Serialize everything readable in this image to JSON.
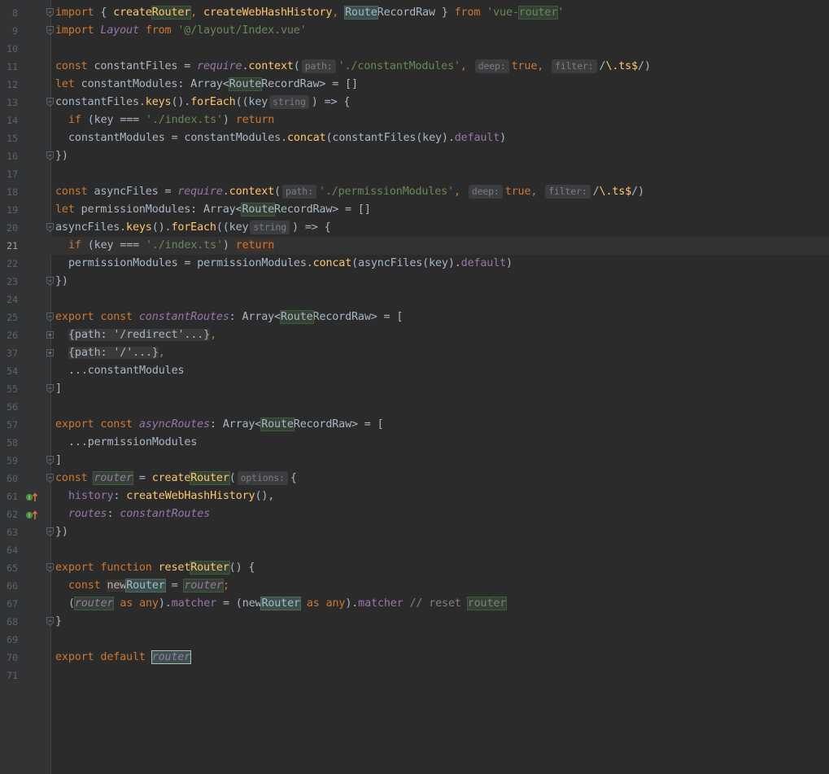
{
  "editor": {
    "current_line": "21",
    "lines": [
      {
        "n": "8"
      },
      {
        "n": "9"
      },
      {
        "n": "10"
      },
      {
        "n": "11"
      },
      {
        "n": "12"
      },
      {
        "n": "13"
      },
      {
        "n": "14"
      },
      {
        "n": "15"
      },
      {
        "n": "16"
      },
      {
        "n": "17"
      },
      {
        "n": "18"
      },
      {
        "n": "19"
      },
      {
        "n": "20"
      },
      {
        "n": "21"
      },
      {
        "n": "22"
      },
      {
        "n": "23"
      },
      {
        "n": "24"
      },
      {
        "n": "25"
      },
      {
        "n": "26"
      },
      {
        "n": "37"
      },
      {
        "n": "54"
      },
      {
        "n": "55"
      },
      {
        "n": "56"
      },
      {
        "n": "57"
      },
      {
        "n": "58"
      },
      {
        "n": "59"
      },
      {
        "n": "60"
      },
      {
        "n": "61"
      },
      {
        "n": "62"
      },
      {
        "n": "63"
      },
      {
        "n": "64"
      },
      {
        "n": "65"
      },
      {
        "n": "66"
      },
      {
        "n": "67"
      },
      {
        "n": "68"
      },
      {
        "n": "69"
      },
      {
        "n": "70"
      },
      {
        "n": "71"
      }
    ],
    "tokens": {
      "l8": [
        "import",
        " { ",
        "create",
        "Router",
        ", ",
        "createWebHashHistory",
        ", ",
        "Route",
        "RecordRaw",
        " } ",
        "from",
        " ",
        "'vue-",
        "router",
        "'"
      ],
      "l9": [
        "import",
        " ",
        "Layout",
        " ",
        "from",
        " ",
        "'@/layout/Index.vue'"
      ],
      "l11": [
        "const",
        " constantFiles = ",
        "require",
        ".",
        "context",
        "(",
        "path:",
        "'./constantModules'",
        ", ",
        "deep:",
        "true",
        ", ",
        "filter:",
        "/",
        "\\.ts",
        "$",
        "/",
        ")"
      ],
      "l12": [
        "let",
        " constantModules: Array<",
        "Route",
        "RecordRaw> = []"
      ],
      "l13": [
        "constantFiles.",
        "keys",
        "().",
        "forEach",
        "((key",
        "string",
        ") => {"
      ],
      "l14": [
        "if",
        " (key === ",
        "'./index.ts'",
        ") ",
        "return"
      ],
      "l15": [
        "constantModules = constantModules.",
        "concat",
        "(constantFiles(key).",
        "default",
        ")"
      ],
      "l16": [
        "})"
      ],
      "l18": [
        "const",
        " asyncFiles = ",
        "require",
        ".",
        "context",
        "(",
        "path:",
        "'./permissionModules'",
        ", ",
        "deep:",
        "true",
        ", ",
        "filter:",
        "/",
        "\\.ts",
        "$",
        "/",
        ")"
      ],
      "l19": [
        "let",
        " permissionModules: Array<",
        "Route",
        "RecordRaw> = []"
      ],
      "l20": [
        "asyncFiles.",
        "keys",
        "().",
        "forEach",
        "((key",
        "string",
        ") => {"
      ],
      "l21": [
        "if",
        " (key === ",
        "'./index.ts'",
        ") ",
        "return"
      ],
      "l22": [
        "permissionModules = permissionModules.",
        "concat",
        "(asyncFiles(key).",
        "default",
        ")"
      ],
      "l23": [
        "})"
      ],
      "l25": [
        "export",
        " ",
        "const",
        " ",
        "constantRoutes",
        ": Array<",
        "Route",
        "RecordRaw> = ["
      ],
      "l26": [
        "{path: '/redirect'...}",
        ","
      ],
      "l37": [
        "{path: '/'...}",
        ","
      ],
      "l54": [
        "...constantModules"
      ],
      "l55": [
        "]"
      ],
      "l57": [
        "export",
        " ",
        "const",
        " ",
        "asyncRoutes",
        ": Array<",
        "Route",
        "RecordRaw> = ["
      ],
      "l58": [
        "...permissionModules"
      ],
      "l59": [
        "]"
      ],
      "l60": [
        "const",
        " ",
        "router",
        " = ",
        "create",
        "Router",
        "(",
        "options:",
        "{"
      ],
      "l61": [
        "history",
        ": ",
        "createWebHashHistory",
        "(),"
      ],
      "l62": [
        "routes",
        ": ",
        "constantRoutes"
      ],
      "l63": [
        "})"
      ],
      "l65": [
        "export",
        " ",
        "function",
        " ",
        "reset",
        "Router",
        "() {"
      ],
      "l66": [
        "const",
        " ",
        "new",
        "Router",
        " = ",
        "router",
        ";"
      ],
      "l67": [
        "(",
        "router",
        " ",
        "as",
        " ",
        "any",
        ").",
        "matcher",
        " = (new",
        "Router",
        " ",
        "as",
        " ",
        "any",
        ").",
        "matcher",
        " ",
        "// reset ",
        "router"
      ],
      "l68": [
        "}"
      ],
      "l70": [
        "export",
        " ",
        "default",
        " ",
        "router"
      ]
    },
    "icons": {
      "override": "implementing-method-icon",
      "fold": "fold-icon"
    }
  }
}
